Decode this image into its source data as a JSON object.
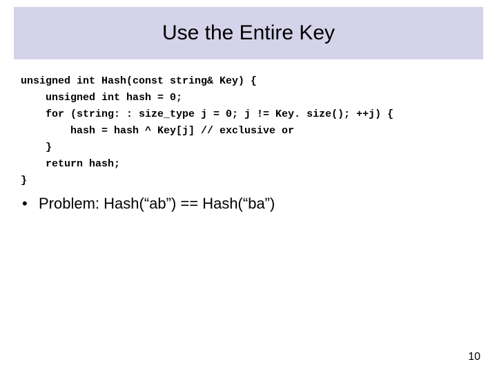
{
  "title": "Use the Entire Key",
  "code": {
    "l1": "unsigned int Hash(const string& Key) {",
    "l2": "    unsigned int hash = 0;",
    "l3": "    for (string: : size_type j = 0; j != Key. size(); ++j) {",
    "l4": "        hash = hash ^ Key[j] // exclusive or",
    "l5": "    }",
    "l6": "    return hash;",
    "l7": "}"
  },
  "bullet": {
    "dot": "•",
    "text": "Problem:  Hash(“ab”) == Hash(“ba”)"
  },
  "page_number": "10"
}
